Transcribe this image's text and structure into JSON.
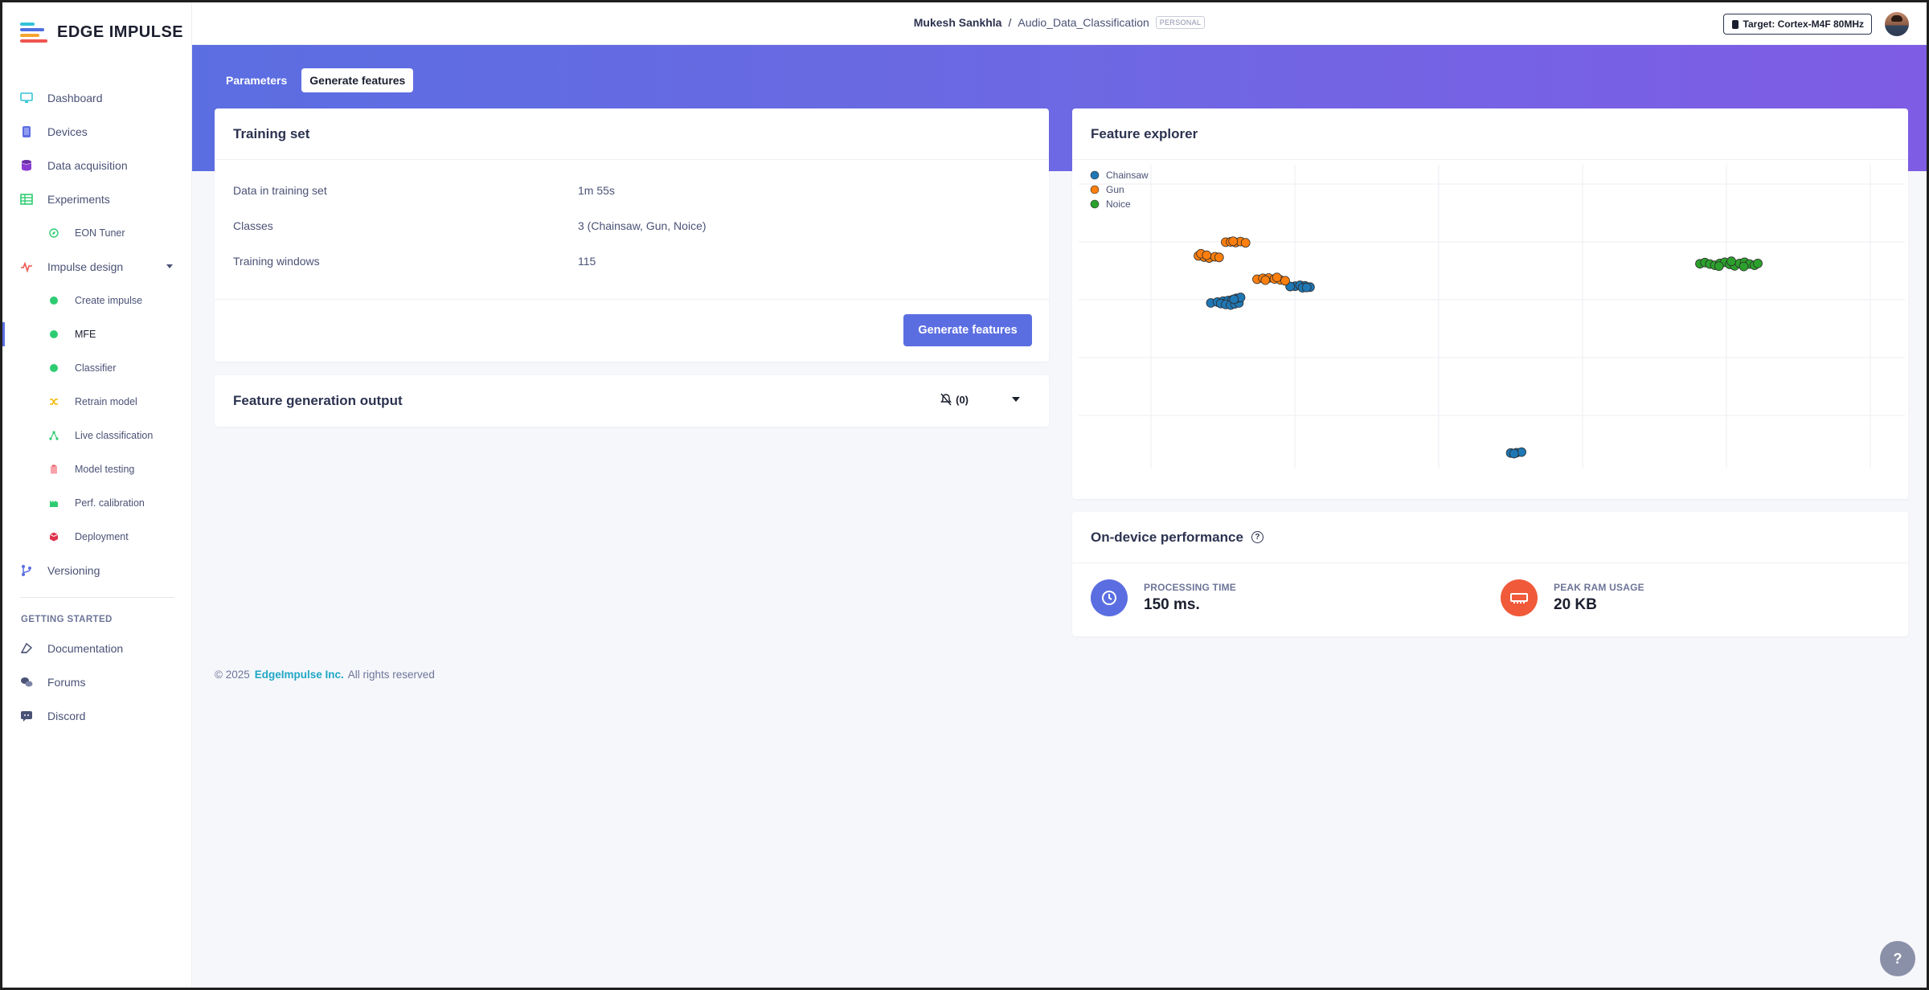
{
  "brand": {
    "name": "EDGE IMPULSE"
  },
  "nav": {
    "dashboard": "Dashboard",
    "devices": "Devices",
    "data_acquisition": "Data acquisition",
    "experiments": "Experiments",
    "eon_tuner": "EON Tuner",
    "impulse_design": "Impulse design",
    "create_impulse": "Create impulse",
    "mfe": "MFE",
    "classifier": "Classifier",
    "retrain_model": "Retrain model",
    "live_classification": "Live classification",
    "model_testing": "Model testing",
    "perf_calibration": "Perf. calibration",
    "deployment": "Deployment",
    "versioning": "Versioning",
    "getting_started_heading": "GETTING STARTED",
    "documentation": "Documentation",
    "forums": "Forums",
    "discord": "Discord"
  },
  "header": {
    "user": "Mukesh Sankhla",
    "separator": "/",
    "project": "Audio_Data_Classification",
    "badge": "PERSONAL",
    "target": "Target: Cortex-M4F 80MHz"
  },
  "tabs": {
    "parameters": "Parameters",
    "generate_features": "Generate features"
  },
  "training_set": {
    "title": "Training set",
    "rows": [
      {
        "label": "Data in training set",
        "value": "1m 55s"
      },
      {
        "label": "Classes",
        "value": "3 (Chainsaw, Gun, Noice)"
      },
      {
        "label": "Training windows",
        "value": "115"
      }
    ],
    "button": "Generate features"
  },
  "feature_output": {
    "title": "Feature generation output",
    "count": "(0)"
  },
  "feature_explorer": {
    "title": "Feature explorer"
  },
  "chart_data": {
    "type": "scatter",
    "title": "",
    "xlabel": "",
    "ylabel": "",
    "grid": true,
    "legend_position": "top-left",
    "series": [
      {
        "name": "Chainsaw",
        "color": "#1f77b4",
        "points": [
          [
            0.16,
            0.455
          ],
          [
            0.168,
            0.452
          ],
          [
            0.175,
            0.449
          ],
          [
            0.181,
            0.447
          ],
          [
            0.186,
            0.445
          ],
          [
            0.172,
            0.457
          ],
          [
            0.178,
            0.46
          ],
          [
            0.184,
            0.462
          ],
          [
            0.189,
            0.458
          ],
          [
            0.194,
            0.455
          ],
          [
            0.191,
            0.44
          ],
          [
            0.196,
            0.437
          ],
          [
            0.188,
            0.443
          ],
          [
            0.262,
            0.4
          ],
          [
            0.268,
            0.397
          ],
          [
            0.274,
            0.399
          ],
          [
            0.28,
            0.403
          ],
          [
            0.271,
            0.405
          ],
          [
            0.276,
            0.404
          ],
          [
            0.256,
            0.401
          ],
          [
            0.523,
            0.949
          ],
          [
            0.53,
            0.948
          ],
          [
            0.536,
            0.946
          ],
          [
            0.527,
            0.951
          ]
        ]
      },
      {
        "name": "Gun",
        "color": "#ff7f0e",
        "points": [
          [
            0.145,
            0.3
          ],
          [
            0.152,
            0.304
          ],
          [
            0.158,
            0.307
          ],
          [
            0.165,
            0.303
          ],
          [
            0.17,
            0.305
          ],
          [
            0.148,
            0.293
          ],
          [
            0.155,
            0.298
          ],
          [
            0.178,
            0.255
          ],
          [
            0.184,
            0.254
          ],
          [
            0.19,
            0.256
          ],
          [
            0.196,
            0.253
          ],
          [
            0.202,
            0.257
          ],
          [
            0.187,
            0.252
          ],
          [
            0.216,
            0.377
          ],
          [
            0.223,
            0.374
          ],
          [
            0.23,
            0.373
          ],
          [
            0.237,
            0.376
          ],
          [
            0.244,
            0.379
          ],
          [
            0.25,
            0.382
          ],
          [
            0.226,
            0.38
          ],
          [
            0.24,
            0.371
          ]
        ]
      },
      {
        "name": "Noice",
        "color": "#2ca02c",
        "points": [
          [
            0.752,
            0.326
          ],
          [
            0.758,
            0.322
          ],
          [
            0.764,
            0.327
          ],
          [
            0.77,
            0.331
          ],
          [
            0.776,
            0.325
          ],
          [
            0.782,
            0.321
          ],
          [
            0.788,
            0.328
          ],
          [
            0.794,
            0.333
          ],
          [
            0.8,
            0.325
          ],
          [
            0.806,
            0.321
          ],
          [
            0.812,
            0.327
          ],
          [
            0.818,
            0.331
          ],
          [
            0.822,
            0.325
          ],
          [
            0.775,
            0.334
          ],
          [
            0.79,
            0.318
          ],
          [
            0.805,
            0.335
          ]
        ]
      }
    ]
  },
  "performance": {
    "title": "On-device performance",
    "help": "?",
    "processing_label": "PROCESSING TIME",
    "processing_value": "150 ms.",
    "ram_label": "PEAK RAM USAGE",
    "ram_value": "20 KB"
  },
  "footer": {
    "copyright": "© 2025",
    "company": "EdgeImpulse Inc.",
    "rights": "All rights reserved"
  },
  "help_button": "?"
}
